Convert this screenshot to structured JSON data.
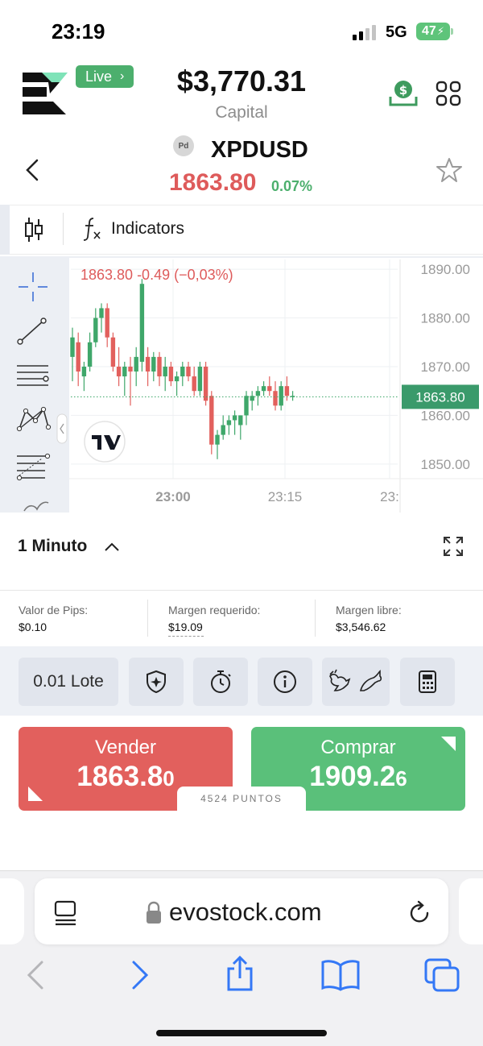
{
  "status_bar": {
    "time": "23:19",
    "network": "5G",
    "battery": "47"
  },
  "header": {
    "live_label": "Live",
    "capital_amount": "$3,770.31",
    "capital_label": "Capital"
  },
  "instrument": {
    "badge": "Pd",
    "symbol": "XPDUSD",
    "price": "1863.80",
    "change_pct": "0.07%"
  },
  "toolbar": {
    "indicators_label": "Indicators"
  },
  "chart_data": {
    "type": "candlestick",
    "ohlc_label": "1863.80 -0.49 (−0,03%)",
    "y_ticks": [
      "1890.00",
      "1880.00",
      "1870.00",
      "1860.00",
      "1850.00"
    ],
    "x_ticks": [
      "23:00",
      "23:15",
      "23:"
    ],
    "last_price_label": "1863.80",
    "ylim": [
      1847,
      1892
    ],
    "last_price": 1863.8,
    "grid": true,
    "candles": [
      {
        "o": 1872,
        "h": 1878,
        "l": 1867,
        "c": 1876
      },
      {
        "o": 1875,
        "h": 1877,
        "l": 1866,
        "c": 1869
      },
      {
        "o": 1868,
        "h": 1871,
        "l": 1865,
        "c": 1870
      },
      {
        "o": 1870,
        "h": 1877,
        "l": 1869,
        "c": 1875
      },
      {
        "o": 1875,
        "h": 1882,
        "l": 1874,
        "c": 1880
      },
      {
        "o": 1880,
        "h": 1883,
        "l": 1877,
        "c": 1882
      },
      {
        "o": 1882,
        "h": 1883,
        "l": 1874,
        "c": 1876
      },
      {
        "o": 1876,
        "h": 1877,
        "l": 1869,
        "c": 1870
      },
      {
        "o": 1870,
        "h": 1874,
        "l": 1866,
        "c": 1868
      },
      {
        "o": 1868,
        "h": 1871,
        "l": 1864,
        "c": 1870
      },
      {
        "o": 1870,
        "h": 1872,
        "l": 1862,
        "c": 1869
      },
      {
        "o": 1869,
        "h": 1874,
        "l": 1866,
        "c": 1872
      },
      {
        "o": 1871,
        "h": 1888,
        "l": 1869,
        "c": 1887
      },
      {
        "o": 1872,
        "h": 1874,
        "l": 1866,
        "c": 1869
      },
      {
        "o": 1869,
        "h": 1873,
        "l": 1867,
        "c": 1872
      },
      {
        "o": 1872,
        "h": 1873,
        "l": 1866,
        "c": 1868
      },
      {
        "o": 1868,
        "h": 1872,
        "l": 1865,
        "c": 1870
      },
      {
        "o": 1870,
        "h": 1871,
        "l": 1866,
        "c": 1867
      },
      {
        "o": 1867,
        "h": 1869,
        "l": 1864,
        "c": 1868
      },
      {
        "o": 1868,
        "h": 1871,
        "l": 1866,
        "c": 1870
      },
      {
        "o": 1870,
        "h": 1871,
        "l": 1867,
        "c": 1868
      },
      {
        "o": 1868,
        "h": 1870,
        "l": 1864,
        "c": 1865
      },
      {
        "o": 1865,
        "h": 1871,
        "l": 1864,
        "c": 1870
      },
      {
        "o": 1870,
        "h": 1871,
        "l": 1862,
        "c": 1863
      },
      {
        "o": 1864,
        "h": 1865,
        "l": 1852,
        "c": 1854
      },
      {
        "o": 1854,
        "h": 1857,
        "l": 1851,
        "c": 1856
      },
      {
        "o": 1856,
        "h": 1860,
        "l": 1855,
        "c": 1858
      },
      {
        "o": 1858,
        "h": 1860,
        "l": 1856,
        "c": 1859
      },
      {
        "o": 1859,
        "h": 1861,
        "l": 1856,
        "c": 1860
      },
      {
        "o": 1858,
        "h": 1860,
        "l": 1855,
        "c": 1860
      },
      {
        "o": 1860,
        "h": 1865,
        "l": 1858,
        "c": 1864
      },
      {
        "o": 1863,
        "h": 1865,
        "l": 1861,
        "c": 1864
      },
      {
        "o": 1864,
        "h": 1866,
        "l": 1862,
        "c": 1865
      },
      {
        "o": 1865,
        "h": 1867,
        "l": 1864,
        "c": 1866
      },
      {
        "o": 1866,
        "h": 1868,
        "l": 1864,
        "c": 1865
      },
      {
        "o": 1865,
        "h": 1867,
        "l": 1861,
        "c": 1862
      },
      {
        "o": 1862,
        "h": 1867,
        "l": 1861,
        "c": 1866
      },
      {
        "o": 1866,
        "h": 1868,
        "l": 1863,
        "c": 1864
      },
      {
        "o": 1864,
        "h": 1865,
        "l": 1863,
        "c": 1864
      }
    ]
  },
  "timeframe": {
    "label": "1 Minuto"
  },
  "stats": {
    "pip_value_label": "Valor de Pips:",
    "pip_value": "$0.10",
    "margin_required_label": "Margen requerido:",
    "margin_required": "$19.09",
    "free_margin_label": "Margen libre:",
    "free_margin": "$3,546.62"
  },
  "actions": {
    "lot_label": "0.01 Lote"
  },
  "trade": {
    "sell_label": "Vender",
    "sell_price_main": "1863.8",
    "sell_price_small": "0",
    "buy_label": "Comprar",
    "buy_price_main": "1909.2",
    "buy_price_small": "6",
    "points_label": "4524 PUNTOS"
  },
  "browser": {
    "url": "evostock.com"
  },
  "colors": {
    "accent_green": "#4caf6d",
    "sell_red": "#e2605d",
    "buy_green": "#5ac07a",
    "price_red": "#de5b5b"
  }
}
